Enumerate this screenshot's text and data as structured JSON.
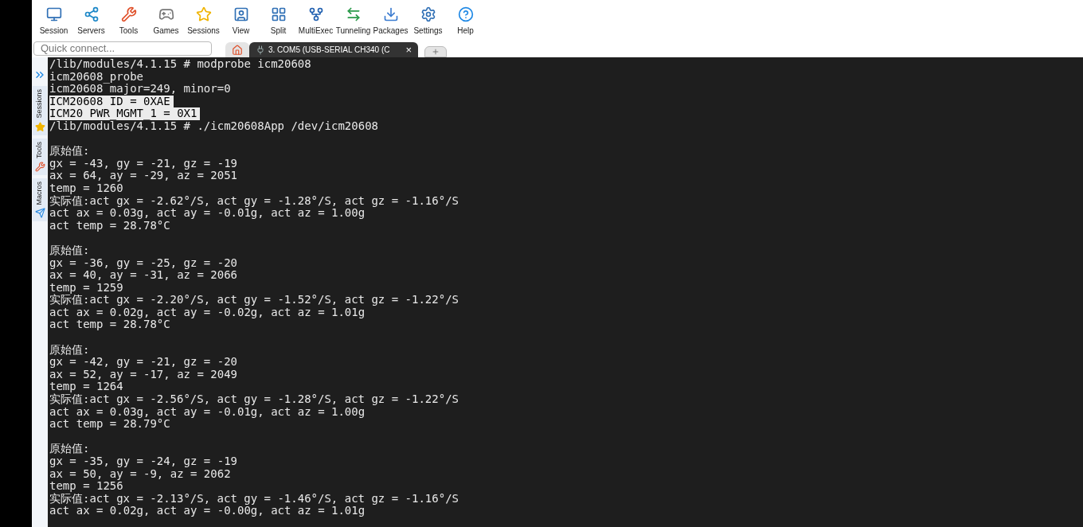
{
  "toolbar": [
    {
      "label": "Session"
    },
    {
      "label": "Servers"
    },
    {
      "label": "Tools"
    },
    {
      "label": "Games"
    },
    {
      "label": "Sessions"
    },
    {
      "label": "View"
    },
    {
      "label": "Split"
    },
    {
      "label": "MultiExec"
    },
    {
      "label": "Tunneling"
    },
    {
      "label": "Packages"
    },
    {
      "label": "Settings"
    },
    {
      "label": "Help"
    }
  ],
  "quick_connect": {
    "placeholder": "Quick connect..."
  },
  "tabs": [
    {
      "kind": "home",
      "selected": false
    },
    {
      "kind": "session",
      "label": "3. COM5  (USB-SERIAL CH340 (C",
      "close": "×",
      "selected": true
    },
    {
      "kind": "new",
      "selected": false
    }
  ],
  "sidebar": {
    "items": [
      {
        "label": "Sessions"
      },
      {
        "label": "Tools"
      },
      {
        "label": "Macros"
      }
    ]
  },
  "terminal": {
    "lines": [
      {
        "text": "/lib/modules/4.1.15 # modprobe icm20608",
        "selected": false
      },
      {
        "text": "icm20608_probe",
        "selected": false
      },
      {
        "text": "icm20608 major=249, minor=0",
        "selected": false
      },
      {
        "text": "ICM20608 ID = 0XAE",
        "selected": true
      },
      {
        "text": "ICM20 PWR_MGMT_1 = 0X1",
        "selected": true
      },
      {
        "text": "/lib/modules/4.1.15 # ./icm20608App /dev/icm20608",
        "selected": false
      }
    ],
    "blocks": [
      [
        "原始值:",
        "gx = -43, gy = -21, gz = -19",
        "ax = 64, ay = -29, az = 2051",
        "temp = 1260",
        "实际值:act gx = -2.62°/S, act gy = -1.28°/S, act gz = -1.16°/S",
        "act ax = 0.03g, act ay = -0.01g, act az = 1.00g",
        "act temp = 28.78°C"
      ],
      [
        "原始值:",
        "gx = -36, gy = -25, gz = -20",
        "ax = 40, ay = -31, az = 2066",
        "temp = 1259",
        "实际值:act gx = -2.20°/S, act gy = -1.52°/S, act gz = -1.22°/S",
        "act ax = 0.02g, act ay = -0.02g, act az = 1.01g",
        "act temp = 28.78°C"
      ],
      [
        "原始值:",
        "gx = -42, gy = -21, gz = -20",
        "ax = 52, ay = -17, az = 2049",
        "temp = 1264",
        "实际值:act gx = -2.56°/S, act gy = -1.28°/S, act gz = -1.22°/S",
        "act ax = 0.03g, act ay = -0.01g, act az = 1.00g",
        "act temp = 28.79°C"
      ],
      [
        "原始值:",
        "gx = -35, gy = -24, gz = -19",
        "ax = 50, ay = -9, az = 2062",
        "temp = 1256",
        "实际值:act gx = -2.13°/S, act gy = -1.46°/S, act gz = -1.16°/S",
        "act ax = 0.02g, act ay = -0.00g, act az = 1.01g"
      ]
    ]
  }
}
